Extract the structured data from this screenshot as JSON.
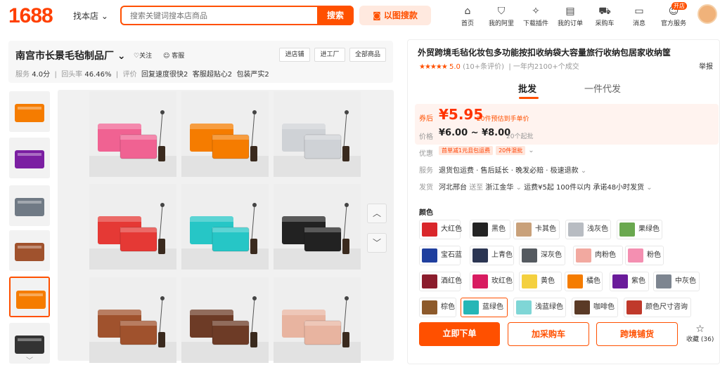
{
  "header": {
    "logo": "1688",
    "find_shop": "找本店",
    "search_placeholder": "搜索关键词搜本店商品",
    "search_button": "搜索",
    "image_search": "以图搜款",
    "nav": [
      {
        "label": "首页",
        "icon": "home-icon"
      },
      {
        "label": "我的阿里",
        "icon": "shield-icon"
      },
      {
        "label": "下载插件",
        "icon": "puzzle-icon"
      },
      {
        "label": "我的订单",
        "icon": "order-icon"
      },
      {
        "label": "采购车",
        "icon": "cart-icon"
      },
      {
        "label": "消息",
        "icon": "message-icon"
      },
      {
        "label": "官方服务",
        "icon": "service-icon"
      }
    ],
    "service_badge": "开店"
  },
  "shop": {
    "name": "南宫市长景毛毡制品厂",
    "follow": "关注",
    "service": "客服",
    "buttons": [
      "进店铺",
      "进工厂",
      "全部商品"
    ],
    "stats": {
      "service_label": "服务",
      "service_score": "4.0分",
      "repurchase_label": "回头率",
      "repurchase": "46.46%",
      "review_label": "评价",
      "review_tags": [
        "回复速度很快2",
        "客服超贴心2",
        "包装严实2"
      ]
    }
  },
  "product": {
    "title": "外贸跨境毛毡化妆包多功能按扣收纳袋大容量旅行收纳包居家收纳筐",
    "rating_score": "5.0",
    "review_count": "(10+条评价)",
    "sales": "一年内2100+个成交",
    "report": "举报",
    "tabs": [
      "批发",
      "一件代发"
    ],
    "price": {
      "after_coupon_label": "券后",
      "after_coupon": "¥5.95",
      "after_coupon_note": "20件预估到手单价",
      "price_label": "价格",
      "range": "¥6.00 ~ ¥8.00",
      "moq": "20个起批"
    },
    "promo_label": "优惠",
    "promos": [
      "首单减1元且包运费",
      "20件混批"
    ],
    "service_label": "服务",
    "services": "退货包运费 · 售后延长 · 晚发必赔 · 极速退款",
    "ship_label": "发货",
    "ship_from": "河北邢台",
    "ship_to_word": "送至",
    "ship_to": "浙江金华",
    "freight": "运费¥5起",
    "qty": "100件以内",
    "promise": "承诺48小时发货",
    "color_label": "颜色",
    "colors": [
      {
        "name": "大红色",
        "hex": "#d9262a"
      },
      {
        "name": "黑色",
        "hex": "#222222"
      },
      {
        "name": "卡其色",
        "hex": "#c9a17a"
      },
      {
        "name": "浅灰色",
        "hex": "#b8bcc2"
      },
      {
        "name": "果绿色",
        "hex": "#6aa84f"
      },
      {
        "name": "宝石蓝",
        "hex": "#1f3f9e"
      },
      {
        "name": "上青色",
        "hex": "#2b3552"
      },
      {
        "name": "深灰色",
        "hex": "#555a60"
      },
      {
        "name": "肉粉色",
        "hex": "#f2a9a0"
      },
      {
        "name": "粉色",
        "hex": "#f48fb1"
      },
      {
        "name": "酒红色",
        "hex": "#8b1c2c"
      },
      {
        "name": "玫红色",
        "hex": "#d81b60"
      },
      {
        "name": "黄色",
        "hex": "#f4d03f"
      },
      {
        "name": "橘色",
        "hex": "#f57c00"
      },
      {
        "name": "紫色",
        "hex": "#6a1b9a"
      },
      {
        "name": "中灰色",
        "hex": "#7d8590"
      },
      {
        "name": "棕色",
        "hex": "#8d5a2b"
      },
      {
        "name": "蓝绿色",
        "hex": "#26b6b6"
      },
      {
        "name": "浅蓝绿色",
        "hex": "#7fd6d6"
      },
      {
        "name": "咖啡色",
        "hex": "#5a3a26"
      },
      {
        "name": "颜色尺寸咨询",
        "hex": "#c0392b"
      }
    ],
    "selected_color": "蓝绿色",
    "buttons": {
      "buy": "立即下单",
      "cart": "加采购车",
      "crossborder": "跨境铺货"
    },
    "favorite": {
      "label": "收藏",
      "count": "(36)"
    }
  },
  "gallery_colors": [
    "#f06292",
    "#f57c00",
    "#cfd2d6",
    "#e53935",
    "#26c6c6",
    "#222222",
    "#a0522d",
    "#6d3b26",
    "#e8b4a0"
  ],
  "thumb_colors": [
    "#f57c00",
    "#7b1fa2",
    "#707a85",
    "#a0522d",
    "#f57c00",
    "#333333"
  ],
  "colors": {
    "accent": "#ff5000",
    "accent_light": "#ffe9df"
  }
}
